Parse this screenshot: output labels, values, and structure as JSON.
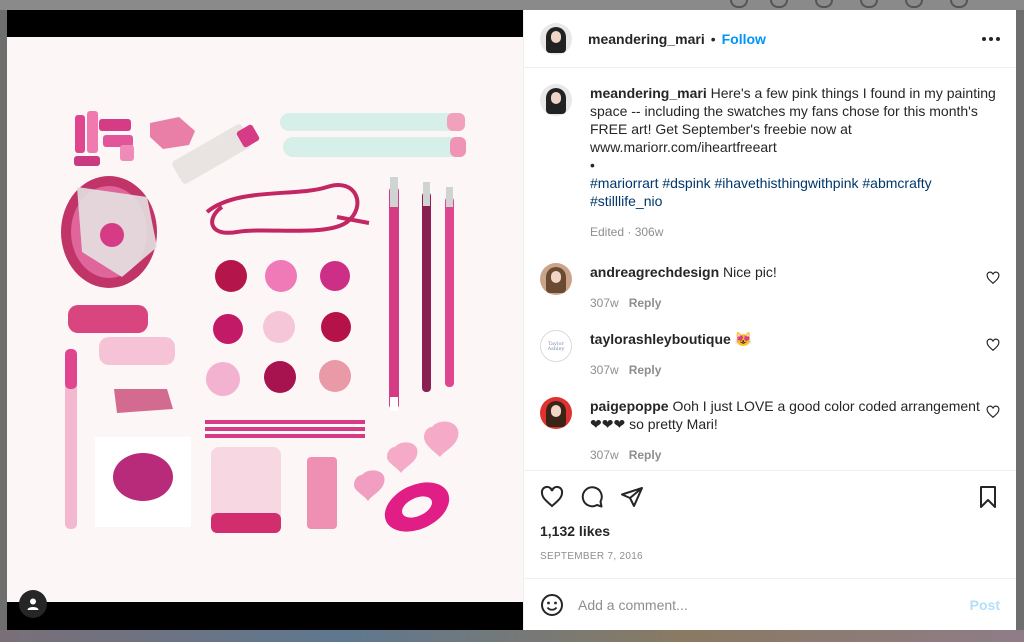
{
  "post": {
    "author": "meandering_mari",
    "follow_label": "Follow",
    "caption": {
      "text": "Here's a few pink things I found in my painting space -- including the swatches my fans chose for this month's FREE art! Get September's freebie now at",
      "link": "www.mariorr.com/iheartfreeart",
      "bullet": "•",
      "hashtags": [
        "#mariorrart",
        "#dspink",
        "#ihavethisthingwithpink",
        "#abmcrafty",
        "#stilllife_nio"
      ],
      "meta": "Edited · 306w"
    },
    "comments": [
      {
        "user": "andreagrechdesign",
        "text": "Nice pic!",
        "age": "307w",
        "reply_label": "Reply"
      },
      {
        "user": "taylorashleyboutique",
        "text": "😻",
        "age": "307w",
        "reply_label": "Reply"
      },
      {
        "user": "paigepoppe",
        "text": "Ooh I just LOVE a good color coded arrangement ❤❤❤ so pretty Mari!",
        "age": "307w",
        "reply_label": "Reply"
      }
    ],
    "likes": "1,132 likes",
    "date": "SEPTEMBER 7, 2016",
    "comment_placeholder": "Add a comment...",
    "post_label": "Post",
    "avatar_logo_text": "Taylor Ashley"
  },
  "colors": {
    "accent": "#0095f6",
    "post_disabled": "#b2dffc",
    "hashtag": "#00376b"
  },
  "icons": [
    "ellipsis-icon",
    "heart-icon",
    "comment-icon",
    "share-icon",
    "bookmark-icon",
    "emoji-icon",
    "user-tag-icon"
  ]
}
